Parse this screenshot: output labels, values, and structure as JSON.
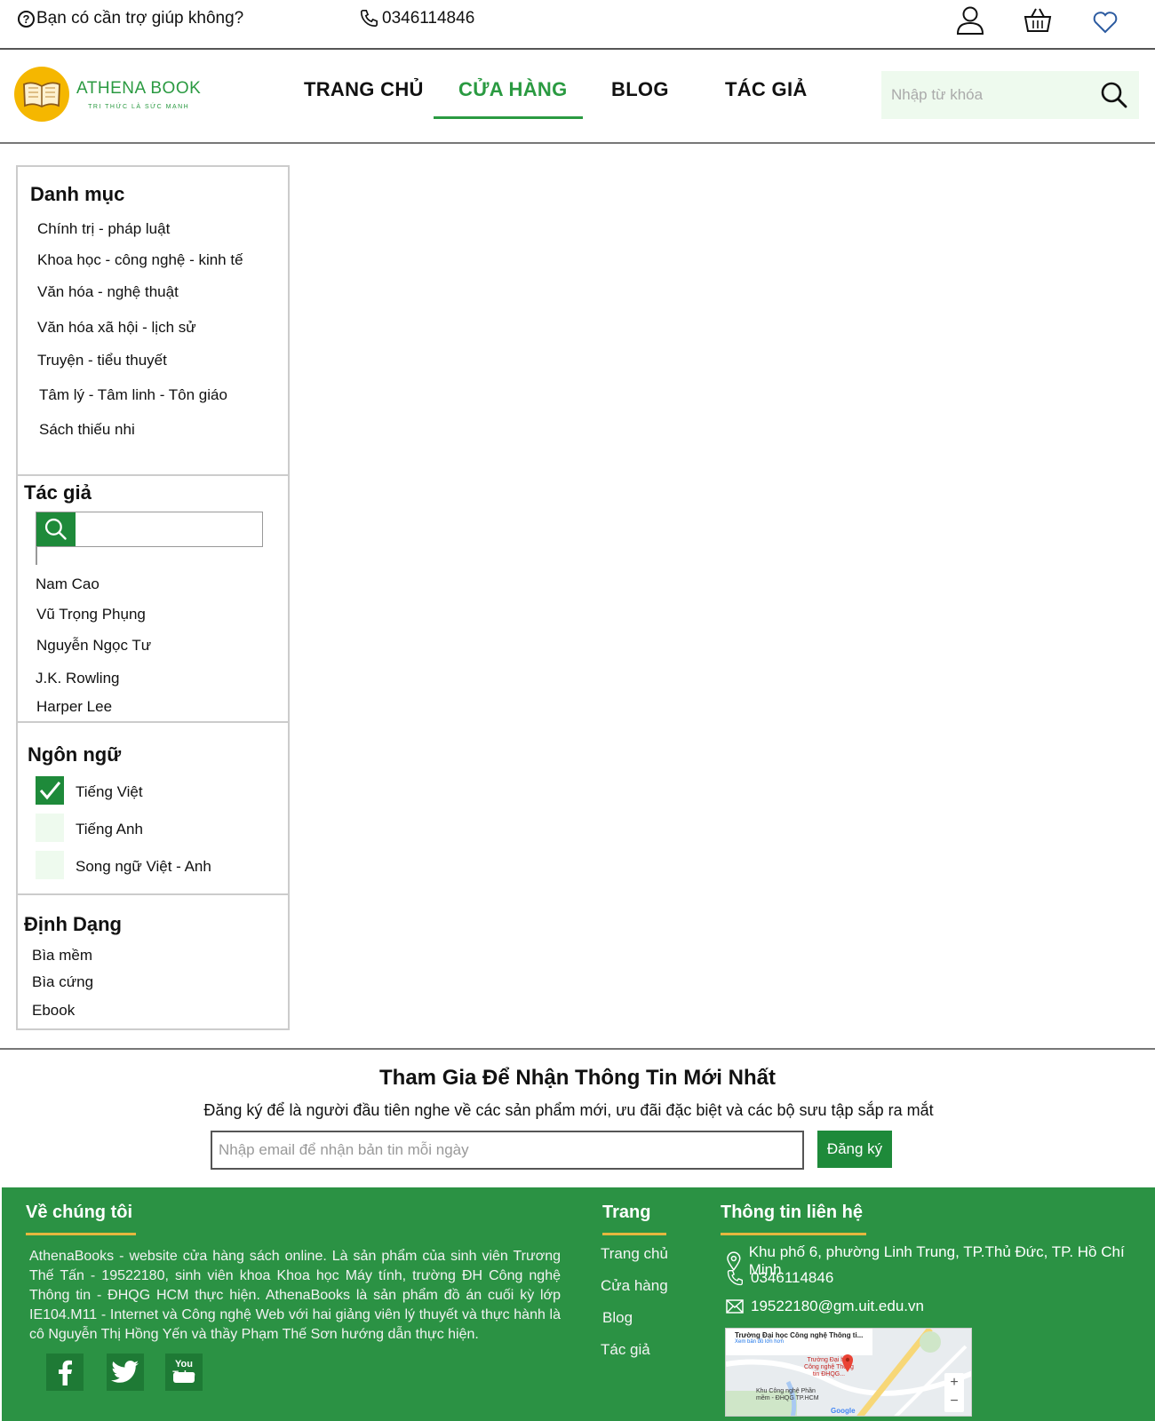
{
  "topbar": {
    "help_text": "Bạn có cần trợ giúp không?",
    "phone": "0346114846",
    "icons": [
      "user-icon",
      "basket-icon",
      "heart-icon"
    ]
  },
  "header": {
    "logo_name": "ATHENA BOOK",
    "logo_slogan": "TRI THỨC LÀ SỨC MẠNH",
    "nav": [
      "TRANG CHỦ",
      "CỬA HÀNG",
      "BLOG",
      "TÁC GIẢ"
    ],
    "active_nav": "CỬA HÀNG",
    "search_placeholder": "Nhập từ khóa"
  },
  "sidebar": {
    "category_title": "Danh mục",
    "categories": [
      "Chính trị - pháp luật",
      "Khoa học - công nghệ - kinh tế",
      "Văn hóa - nghệ thuật",
      "Văn hóa  xã hội - lịch sử",
      "Truyện - tiểu thuyết",
      "Tâm lý - Tâm linh - Tôn giáo",
      "Sách thiếu nhi"
    ],
    "author_title": "Tác giả",
    "authors": [
      "Nam Cao",
      "Vũ Trọng Phụng",
      "Nguyễn Ngọc Tư",
      "J.K. Rowling",
      "Harper Lee"
    ],
    "language_title": "Ngôn ngữ",
    "languages": [
      {
        "label": "Tiếng Việt",
        "checked": true
      },
      {
        "label": "Tiếng Anh",
        "checked": false
      },
      {
        "label": "Song ngữ Việt - Anh",
        "checked": false
      }
    ],
    "format_title": "Định Dạng",
    "formats": [
      "Bìa mềm",
      "Bìa cứng",
      "Ebook"
    ]
  },
  "newsletter": {
    "title": "Tham Gia Để Nhận Thông Tin Mới Nhất",
    "subtitle": "Đăng ký để là người đầu tiên nghe về các sản phẩm mới, ưu đãi đặc biệt và các bộ sưu tập sắp ra mắt",
    "placeholder": "Nhập email để nhận bản tin mỗi ngày",
    "button": "Đăng ký"
  },
  "footer": {
    "about_title": "Về chúng tôi",
    "about_text": "AthenaBooks - website cửa hàng sách online. Là sản phẩm của sinh viên Trương Thế Tấn - 19522180, sinh viên khoa Khoa học Máy tính, trường ĐH Công nghệ Thông tin - ĐHQG HCM thực hiện. AthenaBooks là sản phẩm đồ án cuối kỳ lớp IE104.M11 - Internet và Công nghệ Web với hai giảng viên lý thuyết và thực hành là cô Nguyễn Thị Hồng Yến và thầy Phạm Thế Sơn hướng dẫn thực hiện.",
    "social": [
      "facebook-icon",
      "twitter-icon",
      "youtube-icon"
    ],
    "youtube_logo": "You Tube",
    "pages_title": "Trang",
    "pages": [
      "Trang chủ",
      "Cửa hàng",
      "Blog",
      "Tác giả"
    ],
    "contact_title": "Thông tin liên hệ",
    "address": "Khu phố 6, phường Linh Trung, TP.Thủ Đức, TP. Hồ Chí Minh",
    "phone": "0346114846",
    "email": "19522180@gm.uit.edu.vn",
    "map": {
      "place_name": "Trường Đại học Công nghệ Thông ti...",
      "link": "Xem bản đồ lớn hơn",
      "marker_label": "Trường Đại học Công nghệ Thông tin ĐHQG...",
      "poi": "Khu Công nghệ Phần mềm - ĐHQG TP.HCM",
      "attribution": "Google"
    }
  },
  "colors": {
    "brand_green": "#2a9a41",
    "footer_green": "#2b9244",
    "accent_yellow": "#e6b73e",
    "logo_yellow": "#f5b700"
  }
}
